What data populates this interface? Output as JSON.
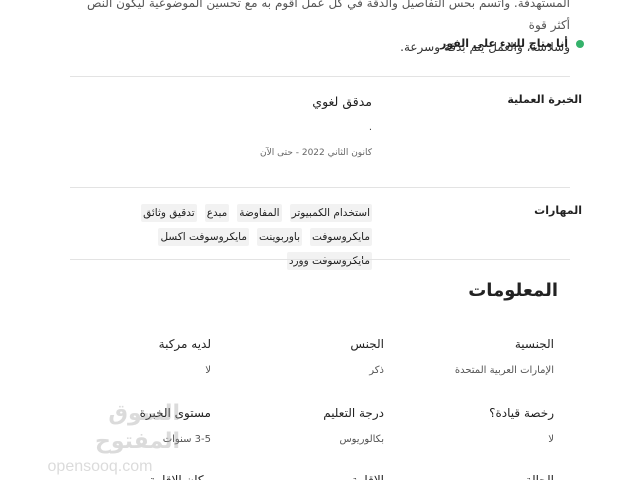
{
  "summary": {
    "line_1": "المستهدفة. وأتسم بحس التفاصيل والدقة في كل عمل أقوم به مع تحسين الموضوعية ليكون النص أكثر قوة",
    "line_2": "وسلاسة، والعمل يتم بدقة وسرعة.",
    "availability": "أنا متاح للبدء على الفور",
    "availability_color": "#35b26b"
  },
  "experience": {
    "section_label": "الخبرة العملية",
    "job_title": "مدقق لغوي",
    "bullet": ".",
    "date_range": "كانون الثاني 2022 - حتى الآن"
  },
  "skills": {
    "section_label": "المهارات",
    "items": [
      "استخدام الكمبيوتر",
      "المفاوضة",
      "مبدع",
      "تدقيق وثائق",
      "مايكروسوفت",
      "باوربوينت",
      "مايكروسوفت اكسل",
      "مايكروسوفت وورد"
    ]
  },
  "info": {
    "title": "المعلومات",
    "fields": [
      {
        "key": "الجنسية",
        "value": "الإمارات العربية المتحدة"
      },
      {
        "key": "الجنس",
        "value": "ذكر"
      },
      {
        "key": "لديه مركبة",
        "value": "لا"
      },
      {
        "key": "رخصة قيادة؟",
        "value": "لا"
      },
      {
        "key": "درجة التعليم",
        "value": "بكالوريوس"
      },
      {
        "key": "مستوى الخبرة",
        "value": "3-5 سنوات"
      },
      {
        "key": "الحالة",
        "value": ""
      },
      {
        "key": "الإقامة",
        "value": ""
      },
      {
        "key": "مكان الإقامة",
        "value": ""
      }
    ]
  },
  "watermark": {
    "arabic": "السوق المفتوح",
    "latin": "opensooq.com"
  }
}
